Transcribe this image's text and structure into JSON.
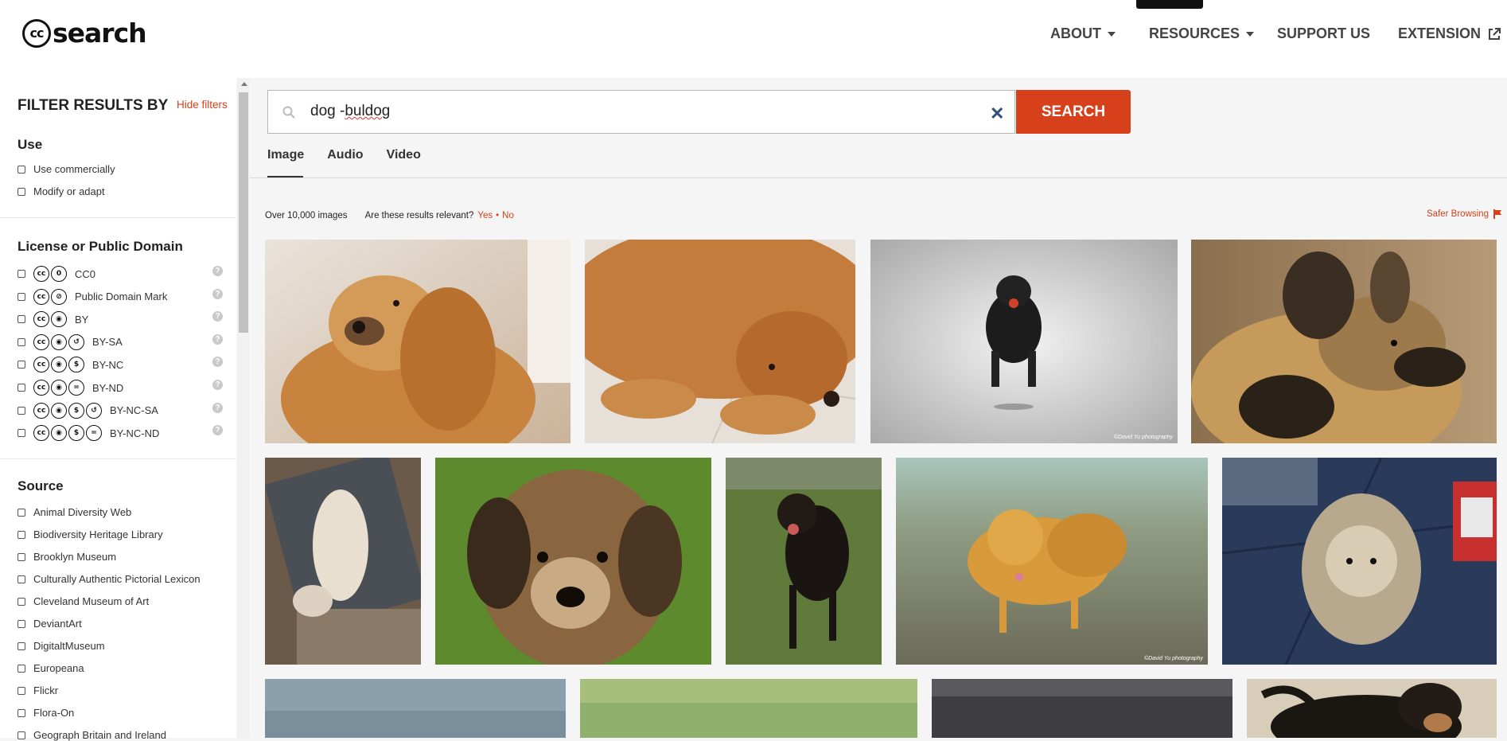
{
  "header": {
    "logo_cc": "cc",
    "logo_text": "search",
    "nav": {
      "about": "ABOUT",
      "resources": "RESOURCES",
      "support": "SUPPORT US",
      "extension": "EXTENSION"
    }
  },
  "sidebar": {
    "title": "FILTER RESULTS BY",
    "hide_filters": "Hide filters",
    "use": {
      "title": "Use",
      "items": [
        "Use commercially",
        "Modify or adapt"
      ]
    },
    "license": {
      "title": "License or Public Domain",
      "items": [
        {
          "label": "CC0",
          "icons": [
            "cc",
            "zero"
          ]
        },
        {
          "label": "Public Domain Mark",
          "icons": [
            "cc",
            "pd"
          ]
        },
        {
          "label": "BY",
          "icons": [
            "cc",
            "by"
          ]
        },
        {
          "label": "BY-SA",
          "icons": [
            "cc",
            "by",
            "sa"
          ]
        },
        {
          "label": "BY-NC",
          "icons": [
            "cc",
            "by",
            "nc"
          ]
        },
        {
          "label": "BY-ND",
          "icons": [
            "cc",
            "by",
            "nd"
          ]
        },
        {
          "label": "BY-NC-SA",
          "icons": [
            "cc",
            "by",
            "nc",
            "sa"
          ]
        },
        {
          "label": "BY-NC-ND",
          "icons": [
            "cc",
            "by",
            "nc",
            "nd"
          ]
        }
      ]
    },
    "source": {
      "title": "Source",
      "items": [
        "Animal Diversity Web",
        "Biodiversity Heritage Library",
        "Brooklyn Museum",
        "Culturally Authentic Pictorial Lexicon",
        "Cleveland Museum of Art",
        "DeviantArt",
        "DigitaltMuseum",
        "Europeana",
        "Flickr",
        "Flora-On",
        "Geograph Britain and Ireland"
      ]
    }
  },
  "search": {
    "query_prefix": "dog -",
    "query_misspelled": "buldog",
    "button": "SEARCH"
  },
  "tabs": [
    "Image",
    "Audio",
    "Video"
  ],
  "results": {
    "count": "Over 10,000 images",
    "relevant_q": "Are these results relevant?",
    "yes": "Yes",
    "sep": "•",
    "no": "No",
    "safer": "Safer Browsing"
  },
  "images": [
    {
      "name": "golden-retriever-smiling",
      "alt": "golden retriever"
    },
    {
      "name": "golden-retriever-lying",
      "alt": "golden retriever lying"
    },
    {
      "name": "rottweiler-running",
      "alt": "rottweiler running on beach",
      "watermark": "©David Yu photography"
    },
    {
      "name": "african-wild-dog",
      "alt": "african wild dog"
    },
    {
      "name": "white-dog-sleeping",
      "alt": "white dog sleeping"
    },
    {
      "name": "terrier-closeup",
      "alt": "terrier close-up"
    },
    {
      "name": "doberman-grass",
      "alt": "doberman on grass"
    },
    {
      "name": "orange-terrier-beach",
      "alt": "orange terrier on beach",
      "watermark": "©David Yu photography"
    },
    {
      "name": "yorkie-floor",
      "alt": "yorkie on floor"
    },
    {
      "name": "dog-photo-row3-1",
      "alt": "dog"
    },
    {
      "name": "dog-photo-row3-2",
      "alt": "dog"
    },
    {
      "name": "dog-photo-row3-3",
      "alt": "dog"
    },
    {
      "name": "dog-photo-row3-4",
      "alt": "black puppy"
    }
  ]
}
